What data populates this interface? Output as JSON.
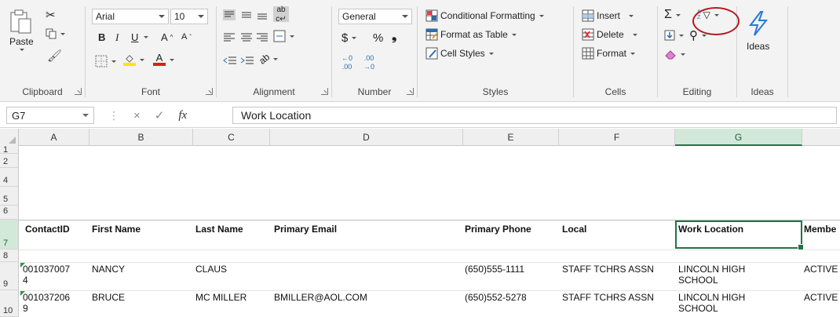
{
  "ribbon": {
    "clipboard": {
      "label": "Clipboard",
      "paste": "Paste"
    },
    "font": {
      "label": "Font",
      "family": "Arial",
      "size": "10",
      "bold": "B",
      "italic": "I",
      "underline": "U",
      "grow": "A",
      "shrink": "A",
      "font_color_letter": "A"
    },
    "alignment": {
      "label": "Alignment"
    },
    "number": {
      "label": "Number",
      "format": "General",
      "currency": "$",
      "percent": "%",
      "comma": "❟"
    },
    "styles": {
      "label": "Styles",
      "conditional_formatting": "Conditional Formatting",
      "format_as_table": "Format as Table",
      "cell_styles": "Cell Styles"
    },
    "cells": {
      "label": "Cells",
      "insert": "Insert",
      "delete": "Delete",
      "format": "Format"
    },
    "editing": {
      "label": "Editing",
      "autosum": "Σ"
    },
    "ideas": {
      "label": "Ideas",
      "button": "Ideas"
    }
  },
  "formula_bar": {
    "name_box": "G7",
    "cancel": "×",
    "enter": "✓",
    "fx": "fx",
    "content": "Work Location"
  },
  "columns": [
    "A",
    "B",
    "C",
    "D",
    "E",
    "F",
    "G"
  ],
  "selected_column": "G",
  "rows": [
    {
      "num": "1"
    },
    {
      "num": "2"
    },
    {
      "num": "4"
    },
    {
      "num": "5"
    },
    {
      "num": "6"
    },
    {
      "num": "7"
    },
    {
      "num": "8"
    },
    {
      "num": "9"
    },
    {
      "num": "10"
    }
  ],
  "headers": {
    "contact_id": "ContactID",
    "first_name": "First Name",
    "last_name": "Last Name",
    "primary_email": "Primary Email",
    "primary_phone": "Primary Phone",
    "local": "Local",
    "work_location": "Work Location",
    "member": "Membe"
  },
  "records": [
    {
      "contact_id_line1": "001037007",
      "contact_id_line2": "4",
      "first_name": "NANCY",
      "last_name": "CLAUS",
      "primary_email": "",
      "primary_phone": "(650)555-1111",
      "local": "STAFF TCHRS ASSN",
      "work_location": "LINCOLN HIGH SCHOOL",
      "member": "ACTIVE"
    },
    {
      "contact_id_line1": "001037206",
      "contact_id_line2": "9",
      "first_name": "BRUCE",
      "last_name": "MC MILLER",
      "primary_email": "BMILLER@AOL.COM",
      "primary_phone": "(650)552-5278",
      "local": "STAFF TCHRS ASSN",
      "work_location": "LINCOLN HIGH SCHOOL",
      "member": "ACTIVE"
    }
  ],
  "colors": {
    "accent": "#217346",
    "highlight_circle": "#b3191f",
    "error_triangle": "#3a8d4c"
  }
}
